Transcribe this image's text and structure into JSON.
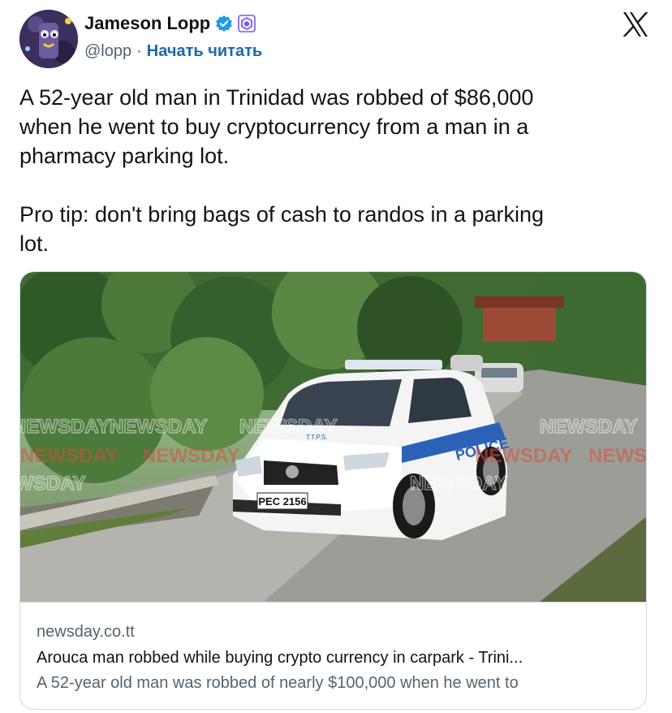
{
  "author": {
    "name": "Jameson Lopp",
    "handle": "@lopp",
    "separator": "·",
    "follow_label": "Начать читать",
    "verified_color": "#1d9bf0",
    "affiliate_color": "#7856ff"
  },
  "tweet": {
    "text": "A 52-year old man in Trinidad was robbed of $86,000\nwhen he went to buy cryptocurrency from a man in a\npharmacy parking lot.\n\nPro tip: don't bring bags of cash to randos in a parking\nlot."
  },
  "card": {
    "domain": "newsday.co.tt",
    "title": "Arouca man robbed while buying crypto currency in carpark - Trini...",
    "description": "A 52-year old man was robbed of nearly $100,000 when he went to",
    "image": {
      "watermark": "NEWSDAY",
      "police_label": "POLICE",
      "plate": "PEC 2156",
      "ttps": "T.T.P.S."
    }
  },
  "icons": {
    "x_logo": "x-logo-icon",
    "verified": "verified-badge-icon",
    "affiliate": "affiliate-badge-icon"
  }
}
